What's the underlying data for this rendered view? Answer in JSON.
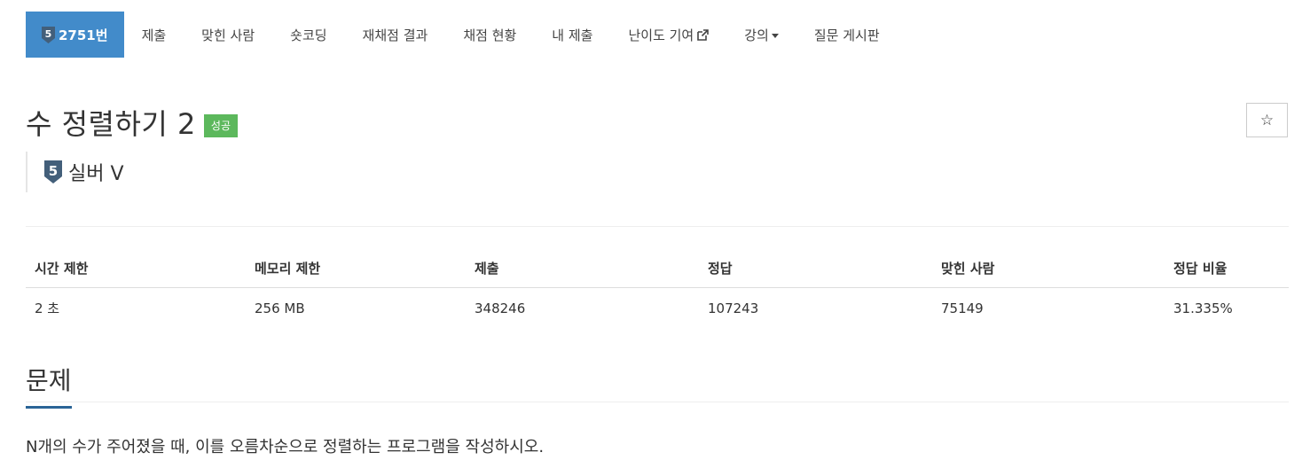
{
  "nav": {
    "tabs": [
      {
        "label": "2751번",
        "active": true
      },
      {
        "label": "제출"
      },
      {
        "label": "맞힌 사람"
      },
      {
        "label": "숏코딩"
      },
      {
        "label": "재채점 결과"
      },
      {
        "label": "채점 현황"
      },
      {
        "label": "내 제출"
      },
      {
        "label": "난이도 기여"
      },
      {
        "label": "강의"
      },
      {
        "label": "질문 게시판"
      }
    ],
    "tier_badge_number": "5"
  },
  "problem": {
    "title": "수 정렬하기 2",
    "result_badge": "성공",
    "star_glyph": "☆",
    "tier_number": "5",
    "tier_label": "실버 V"
  },
  "info_table": {
    "headers": [
      "시간 제한",
      "메모리 제한",
      "제출",
      "정답",
      "맞힌 사람",
      "정답 비율"
    ],
    "values": [
      "2 초",
      "256 MB",
      "348246",
      "107243",
      "75149",
      "31.335%"
    ]
  },
  "section": {
    "title": "문제",
    "text": "N개의 수가 주어졌을 때, 이를 오름차순으로 정렬하는 프로그램을 작성하시오."
  },
  "colors": {
    "active_tab": "#428bca",
    "success_badge": "#5cb85c",
    "tier_silver": "#435f7a",
    "section_underline": "#2a6496"
  }
}
